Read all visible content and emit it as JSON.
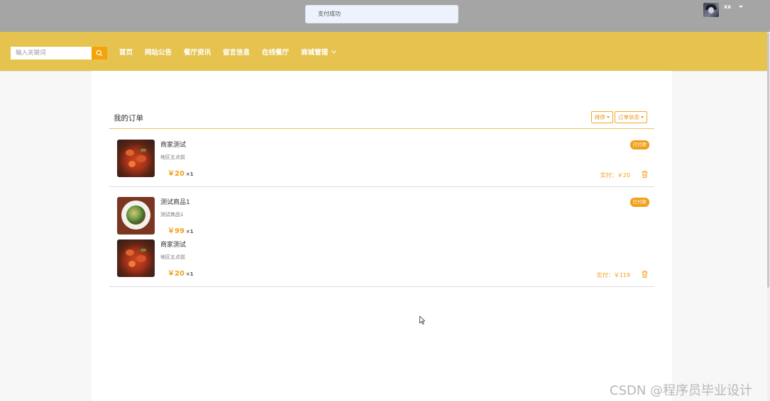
{
  "toast": {
    "message": "支付成功"
  },
  "user": {
    "name": "xx"
  },
  "search": {
    "placeholder": "输入关键词"
  },
  "nav": {
    "items": [
      "首页",
      "网站公告",
      "餐厅资讯",
      "留言信息",
      "在线餐厅",
      "商城管理"
    ]
  },
  "orders_page": {
    "title": "我的订单",
    "sort_label": "排序",
    "status_filter_label": "订单状态",
    "orders": [
      {
        "status": "已付款",
        "paid_label": "实付：￥20",
        "items": [
          {
            "name": "商家测试",
            "desc": "地区五点前",
            "price": "￥20",
            "qty": "×1",
            "image": "spicy-stew"
          }
        ]
      },
      {
        "status": "已付款",
        "paid_label": "实付：￥119",
        "items": [
          {
            "name": "测试商品1",
            "desc": "测试商品1",
            "price": "￥99",
            "qty": "×1",
            "image": "salad-plate"
          },
          {
            "name": "商家测试",
            "desc": "地区五点前",
            "price": "￥20",
            "qty": "×1",
            "image": "spicy-stew"
          }
        ]
      }
    ]
  },
  "watermark": "CSDN @程序员毕业设计",
  "colors": {
    "accent": "#f0a018",
    "navbar": "#e5c34e",
    "topbar": "#a5a5a5"
  }
}
